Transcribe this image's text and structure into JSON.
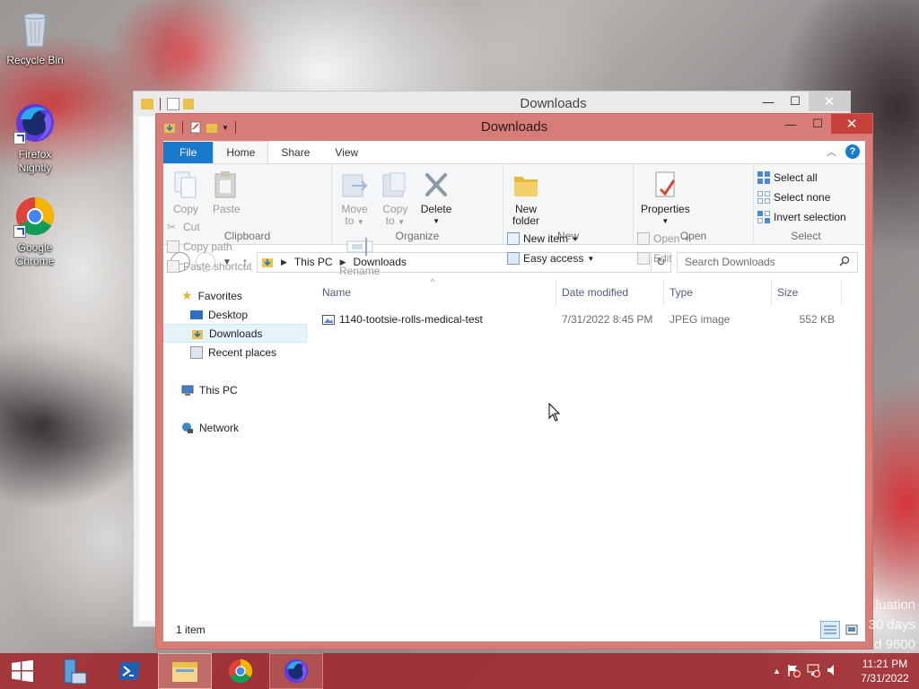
{
  "desktop": {
    "icons": [
      {
        "label": "Recycle Bin",
        "icon": "recycle-bin-icon"
      },
      {
        "label": "Firefox Nightly",
        "icon": "firefox-nightly-icon"
      },
      {
        "label": "Google Chrome",
        "icon": "chrome-icon"
      }
    ],
    "watermark": [
      "luation",
      "30 days",
      "d 9600"
    ]
  },
  "back_window": {
    "title": "Downloads"
  },
  "window": {
    "title": "Downloads",
    "colors": {
      "frame": "#d87c78",
      "accent": "#1979ca",
      "close": "#c7403a"
    },
    "tabs": [
      {
        "label": "File"
      },
      {
        "label": "Home"
      },
      {
        "label": "Share"
      },
      {
        "label": "View"
      }
    ],
    "ribbon": {
      "clipboard": {
        "label": "Clipboard",
        "copy": "Copy",
        "paste": "Paste",
        "cut": "Cut",
        "copy_path": "Copy path",
        "paste_shortcut": "Paste shortcut"
      },
      "organize": {
        "label": "Organize",
        "move_to": [
          "Move",
          "to"
        ],
        "copy_to": [
          "Copy",
          "to"
        ],
        "delete": "Delete",
        "rename": "Rename"
      },
      "new": {
        "label": "New",
        "new_folder": [
          "New",
          "folder"
        ],
        "new_item": "New item",
        "easy_access": "Easy access"
      },
      "open": {
        "label": "Open",
        "properties": "Properties",
        "open": "Open",
        "edit": "Edit"
      },
      "select": {
        "label": "Select",
        "select_all": "Select all",
        "select_none": "Select none",
        "invert_selection": "Invert selection"
      }
    },
    "address": {
      "crumbs": [
        "This PC",
        "Downloads"
      ],
      "search_placeholder": "Search Downloads"
    },
    "nav": {
      "favorites": "Favorites",
      "desktop": "Desktop",
      "downloads": "Downloads",
      "recent_places": "Recent places",
      "this_pc": "This PC",
      "network": "Network"
    },
    "columns": {
      "name": "Name",
      "date_modified": "Date modified",
      "type": "Type",
      "size": "Size"
    },
    "files": [
      {
        "name": "1140-tootsie-rolls-medical-test",
        "date_modified": "7/31/2022 8:45 PM",
        "type": "JPEG image",
        "size": "552 KB"
      }
    ],
    "status": "1 item"
  },
  "taskbar": {
    "apps": [
      {
        "icon": "server-manager-icon"
      },
      {
        "icon": "powershell-icon"
      },
      {
        "icon": "file-explorer-icon",
        "state": "active"
      },
      {
        "icon": "chrome-icon"
      },
      {
        "icon": "firefox-nightly-icon",
        "state": "open"
      }
    ],
    "clock": {
      "time": "11:21 PM",
      "date": "7/31/2022"
    }
  }
}
